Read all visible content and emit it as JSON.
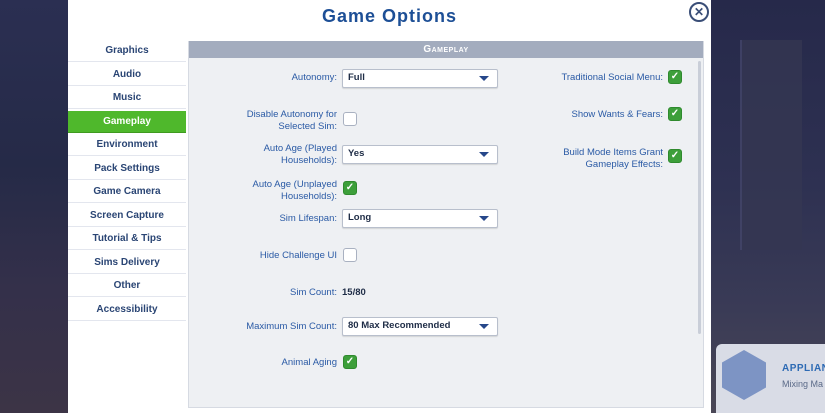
{
  "window": {
    "title": "Game Options"
  },
  "sidebar": {
    "items": [
      {
        "label": "Graphics",
        "active": false
      },
      {
        "label": "Audio",
        "active": false
      },
      {
        "label": "Music",
        "active": false
      },
      {
        "label": "Gameplay",
        "active": true
      },
      {
        "label": "Environment",
        "active": false
      },
      {
        "label": "Pack Settings",
        "active": false
      },
      {
        "label": "Game Camera",
        "active": false
      },
      {
        "label": "Screen Capture",
        "active": false
      },
      {
        "label": "Tutorial & Tips",
        "active": false
      },
      {
        "label": "Sims Delivery",
        "active": false
      },
      {
        "label": "Other",
        "active": false
      },
      {
        "label": "Accessibility",
        "active": false
      }
    ]
  },
  "section": {
    "title": "Gameplay"
  },
  "settings": {
    "autonomy": {
      "label": "Autonomy:",
      "value": "Full"
    },
    "disable_autonomy": {
      "label": "Disable Autonomy for Selected Sim:",
      "checked": false
    },
    "auto_age_played": {
      "label": "Auto Age (Played Households):",
      "value": "Yes"
    },
    "auto_age_unplayed": {
      "label": "Auto Age (Unplayed Households):",
      "checked": true
    },
    "sim_lifespan": {
      "label": "Sim Lifespan:",
      "value": "Long"
    },
    "hide_challenge_ui": {
      "label": "Hide Challenge UI",
      "checked": false
    },
    "sim_count": {
      "label": "Sim Count:",
      "value": "15/80"
    },
    "max_sim_count": {
      "label": "Maximum Sim Count:",
      "value": "80 Max Recommended"
    },
    "animal_aging": {
      "label": "Animal Aging",
      "checked": true
    },
    "traditional_social_menu": {
      "label": "Traditional Social Menu:",
      "checked": true
    },
    "show_wants_fears": {
      "label": "Show Wants & Fears:",
      "checked": true
    },
    "build_mode_items": {
      "label": "Build Mode Items Grant Gameplay Effects:",
      "checked": true
    }
  },
  "background": {
    "card_title": "APPLIANC",
    "card_subtitle": "Mixing Ma"
  },
  "colors": {
    "accent_green": "#4fb82c",
    "title_blue": "#1d4f96",
    "label_blue": "#2a5aa5"
  },
  "icons": {
    "close": "close-icon",
    "checkmark": "checkmark-icon",
    "dropdown": "chevron-down-icon"
  }
}
